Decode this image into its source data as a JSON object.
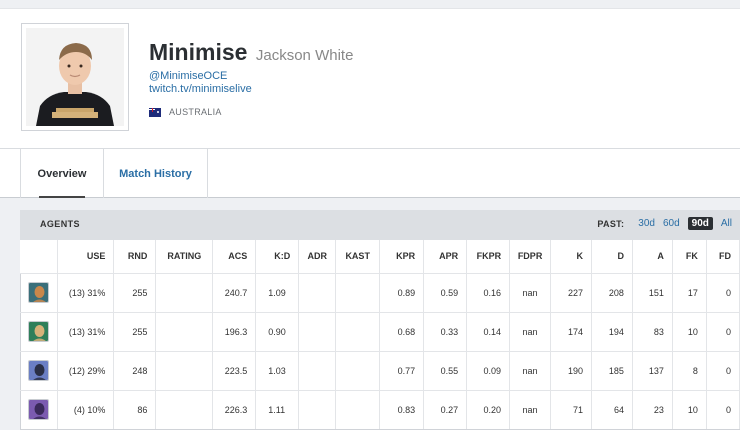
{
  "profile": {
    "name": "Minimise",
    "real_name": "Jackson White",
    "handle": "@MinimiseOCE",
    "twitch": "twitch.tv/minimiselive",
    "country": "AUSTRALIA",
    "avatar": "player-photo",
    "flag": "australia-flag-icon"
  },
  "tabs": {
    "overview": "Overview",
    "match_history": "Match History"
  },
  "agents": {
    "title": "AGENTS",
    "past_label": "PAST:",
    "past_options": [
      "30d",
      "60d",
      "90d",
      "All"
    ],
    "past_selected": "90d",
    "columns": [
      "",
      "USE",
      "RND",
      "RATING",
      "ACS",
      "K:D",
      "ADR",
      "KAST",
      "KPR",
      "APR",
      "FKPR",
      "FDPR",
      "K",
      "D",
      "A",
      "FK",
      "FD"
    ],
    "rows": [
      {
        "icon": "agent-icon-1",
        "colors": [
          "#c9874b",
          "#3a6f7a"
        ],
        "use": "(13) 31%",
        "rnd": "255",
        "rating": "",
        "acs": "240.7",
        "kd": "1.09",
        "adr": "",
        "kast": "",
        "kpr": "0.89",
        "apr": "0.59",
        "fkpr": "0.16",
        "fdpr": "nan",
        "k": "227",
        "d": "208",
        "a": "151",
        "fk": "17",
        "fd": "0"
      },
      {
        "icon": "agent-icon-2",
        "colors": [
          "#d7b27a",
          "#2f7f5a"
        ],
        "use": "(13) 31%",
        "rnd": "255",
        "rating": "",
        "acs": "196.3",
        "kd": "0.90",
        "adr": "",
        "kast": "",
        "kpr": "0.68",
        "apr": "0.33",
        "fkpr": "0.14",
        "fdpr": "nan",
        "k": "174",
        "d": "194",
        "a": "83",
        "fk": "10",
        "fd": "0"
      },
      {
        "icon": "agent-icon-3",
        "colors": [
          "#2a2f45",
          "#6b7fc4"
        ],
        "use": "(12) 29%",
        "rnd": "248",
        "rating": "",
        "acs": "223.5",
        "kd": "1.03",
        "adr": "",
        "kast": "",
        "kpr": "0.77",
        "apr": "0.55",
        "fkpr": "0.09",
        "fdpr": "nan",
        "k": "190",
        "d": "185",
        "a": "137",
        "fk": "8",
        "fd": "0"
      },
      {
        "icon": "agent-icon-4",
        "colors": [
          "#3a2a5a",
          "#7b5bb0"
        ],
        "use": "(4) 10%",
        "rnd": "86",
        "rating": "",
        "acs": "226.3",
        "kd": "1.11",
        "adr": "",
        "kast": "",
        "kpr": "0.83",
        "apr": "0.27",
        "fkpr": "0.20",
        "fdpr": "nan",
        "k": "71",
        "d": "64",
        "a": "23",
        "fk": "10",
        "fd": "0"
      }
    ]
  }
}
